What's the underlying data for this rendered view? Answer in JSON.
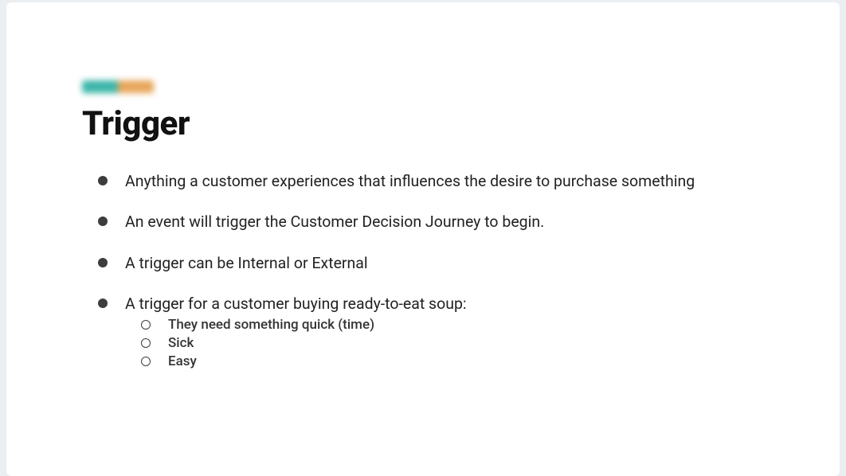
{
  "slide": {
    "title": "Trigger",
    "bullets": [
      {
        "text": "Anything a customer experiences that influences the desire to purchase something"
      },
      {
        "text": "An event will trigger the Customer Decision Journey to begin."
      },
      {
        "text": "A trigger can be Internal or External"
      },
      {
        "text": "A trigger for a customer buying ready-to-eat soup:",
        "sub": [
          "They need something quick (time)",
          "Sick",
          "Easy"
        ]
      }
    ]
  }
}
